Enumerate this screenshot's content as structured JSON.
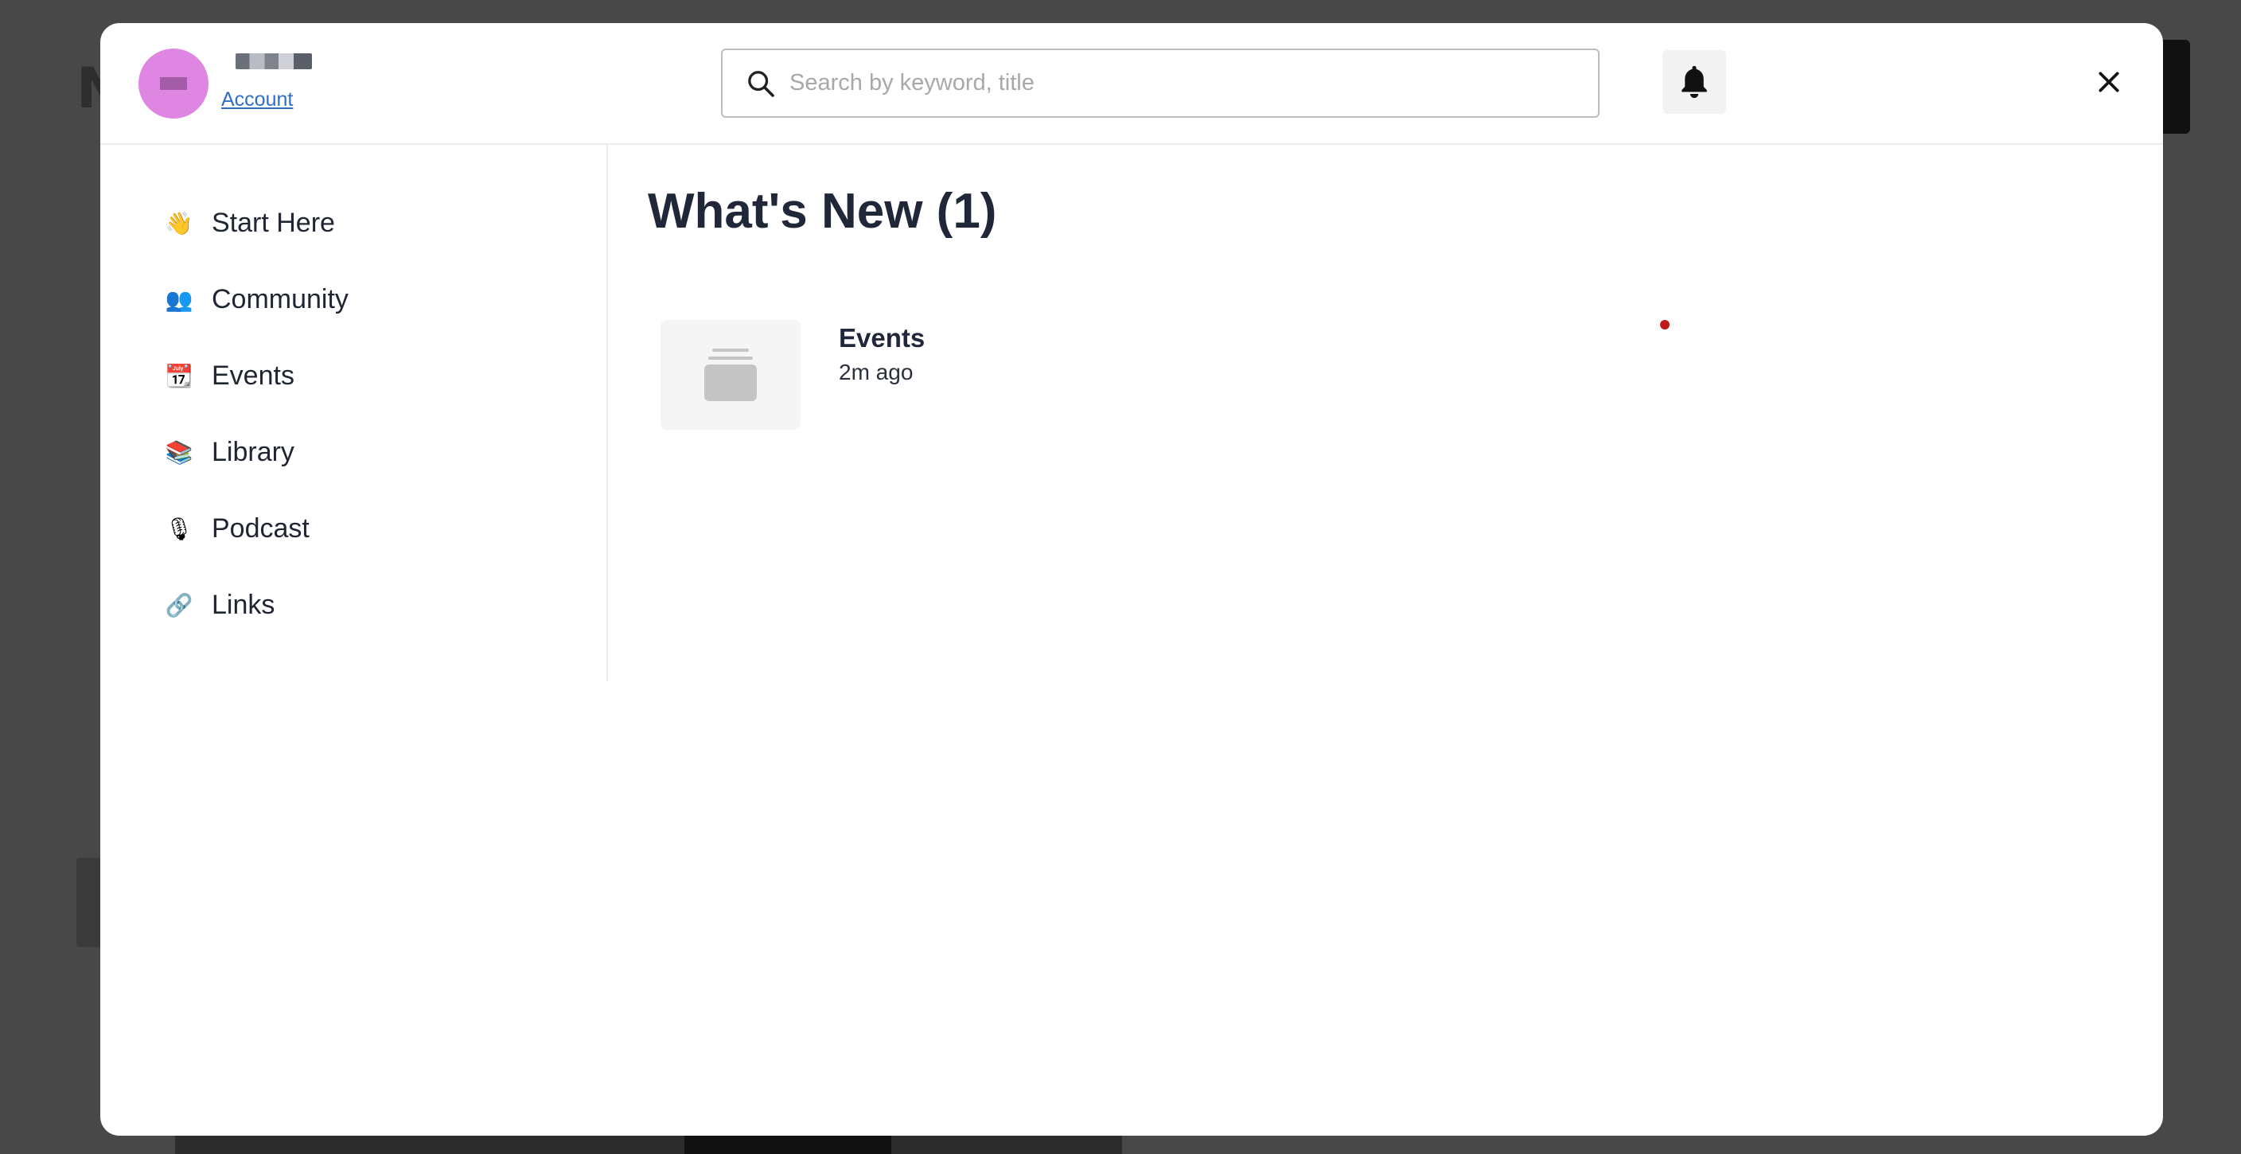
{
  "header": {
    "account_link": "Account",
    "search": {
      "placeholder": "Search by keyword, title",
      "value": ""
    }
  },
  "sidebar": {
    "items": [
      {
        "label": "Start Here",
        "emoji": "👋",
        "icon": "waving-hand-icon"
      },
      {
        "label": "Community",
        "emoji": "👥",
        "icon": "people-icon"
      },
      {
        "label": "Events",
        "emoji": "📆",
        "icon": "calendar-icon"
      },
      {
        "label": "Library",
        "emoji": "📚",
        "icon": "books-icon"
      },
      {
        "label": "Podcast",
        "emoji": "🎙",
        "icon": "microphone-icon"
      },
      {
        "label": "Links",
        "emoji": "🔗",
        "icon": "link-icon"
      }
    ]
  },
  "main": {
    "title": "What's New (1)",
    "items": [
      {
        "title": "Events",
        "time": "2m ago",
        "unread": true
      }
    ]
  },
  "colors": {
    "avatar": "#df86e3",
    "link": "#2f6ec7",
    "title_text": "#1f2738",
    "unread_dot": "#c0191d",
    "overlay": "#4a4a4a"
  }
}
